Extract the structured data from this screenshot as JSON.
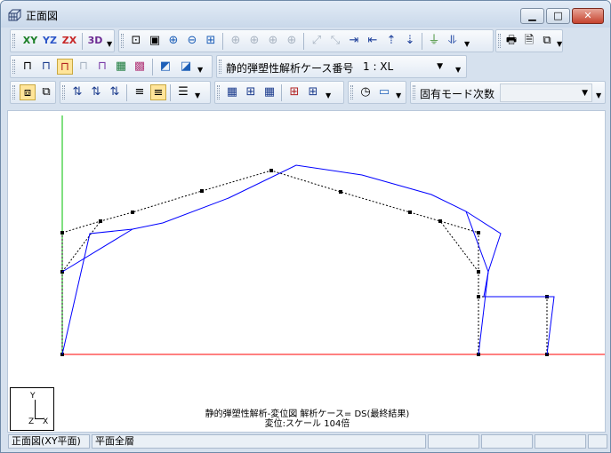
{
  "window": {
    "title": "正面図"
  },
  "toolbar1": {
    "view_xy": "XY",
    "view_yz": "YZ",
    "view_zx": "ZX",
    "view_3d": "3D"
  },
  "toolbar2": {
    "case_label": "静的弾塑性解析ケース番号",
    "case_value": "1 : XL"
  },
  "toolbar3": {
    "mode_label": "固有モード次数",
    "mode_value": ""
  },
  "canvas": {
    "axis": {
      "y": "Y",
      "z": "Z",
      "x": "X"
    },
    "caption_line1": "静的弾塑性解析-変位図 解析ケース= DS(最終結果)",
    "caption_line2": "変位:スケール 104倍",
    "colors": {
      "deformed": "#0000ff",
      "original": "#000000",
      "ground": "#ff0000",
      "y_axis": "#00c000"
    }
  },
  "statusbar": {
    "view_name": "正面図(XY平面)",
    "floor": "平面全層",
    "cell3": "",
    "cell4": "",
    "cell5": "",
    "cell6": ""
  }
}
